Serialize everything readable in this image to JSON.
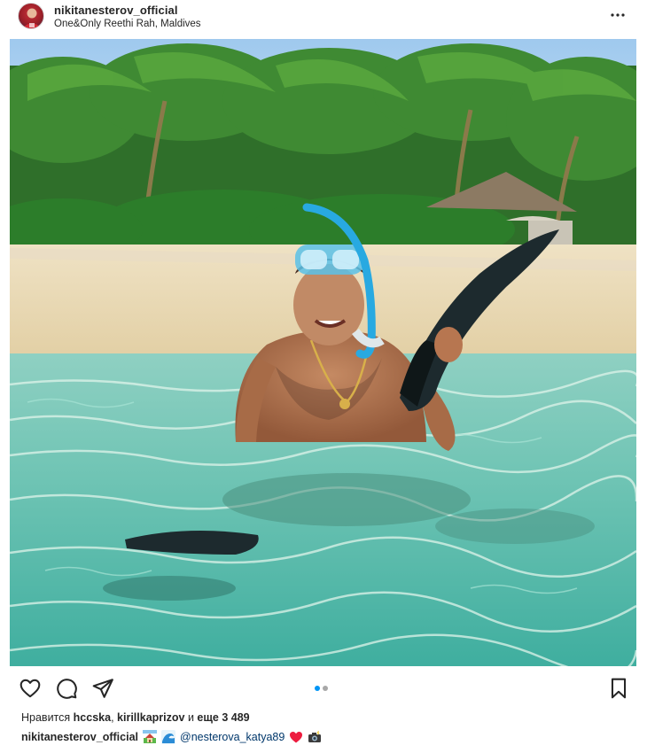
{
  "post": {
    "username": "nikitanesterov_official",
    "location": "One&Only Reethi Rah, Maldives"
  },
  "icons": {
    "more": "more-horizontal-icon",
    "like": "heart-icon",
    "comment": "comment-icon",
    "share": "paper-plane-icon",
    "save": "bookmark-icon"
  },
  "carousel": {
    "current": 1,
    "total": 2
  },
  "likes": {
    "prefix": "Нравится",
    "user1": "hccska",
    "separator": ",",
    "user2": "kirillkaprizov",
    "and": "и",
    "others": "еще 3 489"
  },
  "caption": {
    "username": "nikitanesterov_official",
    "mention": "@nesterova_katya89",
    "emojis": [
      "house-with-garden",
      "water-wave",
      "red-heart",
      "camera-with-flash"
    ]
  },
  "colors": {
    "accent": "#0095f6",
    "mention": "#00376b",
    "text": "#262626",
    "heart": "#ed1c3f"
  }
}
